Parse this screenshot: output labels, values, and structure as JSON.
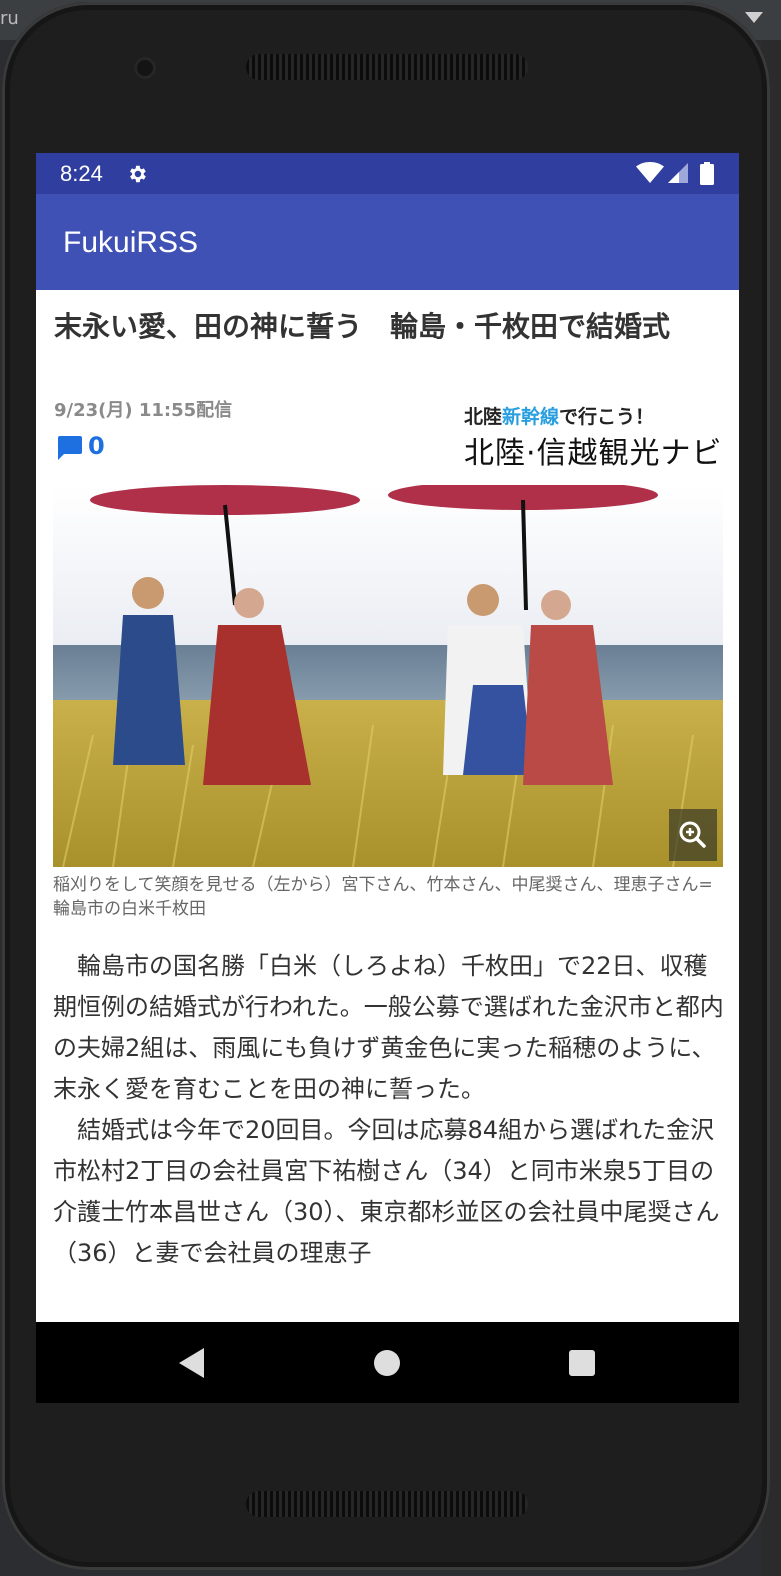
{
  "ide": {
    "tab_fragment": "ru"
  },
  "status_bar": {
    "time": "8:24"
  },
  "app_bar": {
    "title": "FukuiRSS"
  },
  "article": {
    "headline": "末永い愛、田の神に誓う　輪島・千枚田で結婚式",
    "date": "9/23(月) 11:55配信",
    "comment_count": "0",
    "ad": {
      "line1_prefix": "北陸",
      "line1_highlight": "新幹線",
      "line1_suffix": "で行こう！",
      "line2": "北陸·信越観光ナビ"
    },
    "caption": "稲刈りをして笑顔を見せる（左から）宮下さん、竹本さん、中尾奨さん、理恵子さん=輪島市の白米千枚田",
    "paragraphs": [
      "輪島市の国名勝「白米（しろよね）千枚田」で22日、収穫期恒例の結婚式が行われた。一般公募で選ばれた金沢市と都内の夫婦2組は、雨風にも負けず黄金色に実った稲穂のように、末永く愛を育むことを田の神に誓った。",
      "結婚式は今年で20回目。今回は応募84組から選ばれた金沢市松村2丁目の会社員宮下祐樹さん（34）と同市米泉5丁目の介護士竹本昌世さん（30）、東京都杉並区の会社員中尾奨さん（36）と妻で会社員の理恵子"
    ]
  },
  "colors": {
    "status_bar": "#303f9f",
    "app_bar": "#3f51b5",
    "comment_accent": "#1e6fe0"
  }
}
